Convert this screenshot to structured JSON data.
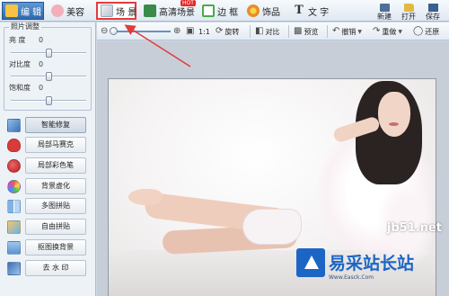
{
  "tabs": [
    {
      "label": "编 辑",
      "icon": "edit-icon"
    },
    {
      "label": "美容",
      "icon": "beauty-icon"
    },
    {
      "label": "场 景",
      "icon": "scene-icon"
    },
    {
      "label": "高清场景",
      "icon": "hd-scene-icon",
      "badge": "HOT"
    },
    {
      "label": "边 框",
      "icon": "frame-icon"
    },
    {
      "label": "饰品",
      "icon": "ornament-icon"
    },
    {
      "label": "文 字",
      "icon": "text-icon"
    }
  ],
  "right_actions": {
    "new": "新建",
    "open": "打开",
    "save": "保存"
  },
  "adjust": {
    "title": "照片调整",
    "brightness": {
      "label": "亮 度",
      "value": "0",
      "level": 0.5
    },
    "contrast": {
      "label": "对比度",
      "value": "0",
      "level": 0.5
    },
    "saturation": {
      "label": "饱和度",
      "value": "0",
      "level": 0.5
    }
  },
  "tools": [
    {
      "label": "智能修复",
      "icon": "smart-repair-icon"
    },
    {
      "label": "局部马赛克",
      "icon": "mosaic-icon"
    },
    {
      "label": "局部彩色笔",
      "icon": "color-pen-icon"
    },
    {
      "label": "背景虚化",
      "icon": "background-blur-icon"
    },
    {
      "label": "多图拼贴",
      "icon": "multi-collage-icon"
    },
    {
      "label": "自由拼贴",
      "icon": "free-collage-icon"
    },
    {
      "label": "抠图换背景",
      "icon": "cutout-icon"
    },
    {
      "label": "去 水 印",
      "icon": "remove-watermark-icon"
    }
  ],
  "image_toolbar": {
    "zoom_level": 0.0,
    "actual_size": "1:1",
    "rotate": "旋转",
    "compare": "对比",
    "preview": "预览",
    "undo": "撤销",
    "redo": "重做",
    "restore": "还原"
  },
  "watermark": {
    "site": "jb51.net",
    "brand": "易采站长站",
    "url": "Www.Easck.Com"
  },
  "colors": {
    "active_tab": "#2d68ad",
    "highlight": "#e23b3b",
    "brand_blue": "#1b66c4"
  }
}
